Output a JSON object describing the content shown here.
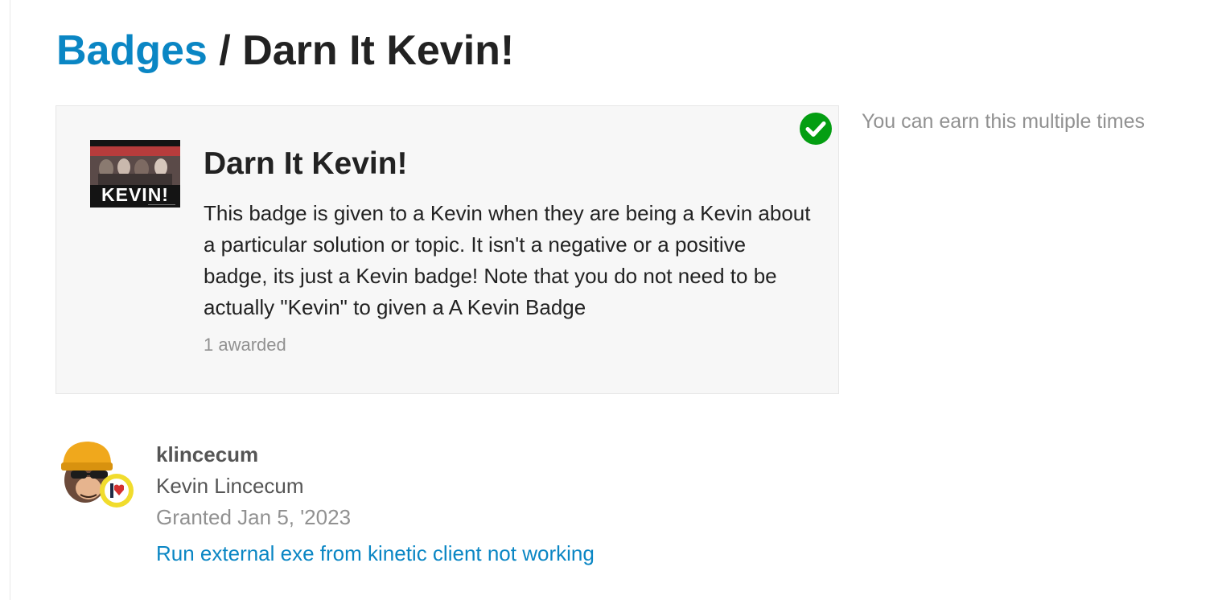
{
  "breadcrumb": {
    "parent": "Badges",
    "separator": " / ",
    "current": "Darn It Kevin!"
  },
  "badge": {
    "thumbnail_text": "KEVIN!",
    "status_icon": "check-circle-icon",
    "name": "Darn It Kevin!",
    "description": "This badge is given to a Kevin when they are being a Kevin about a particular solution or topic. It isn't a negative or a positive badge, its just a Kevin badge! Note that you do not need to be actually \"Kevin\" to given a A Kevin Badge",
    "awarded": "1 awarded"
  },
  "sidebar_note": "You can earn this multiple times",
  "grant": {
    "username": "klincecum",
    "full_name": "Kevin Lincecum",
    "granted": "Granted Jan 5, '2023",
    "topic": "Run external exe from kinetic client not working"
  },
  "colors": {
    "link": "#0a86c4",
    "success": "#049e12",
    "muted": "#919191"
  }
}
